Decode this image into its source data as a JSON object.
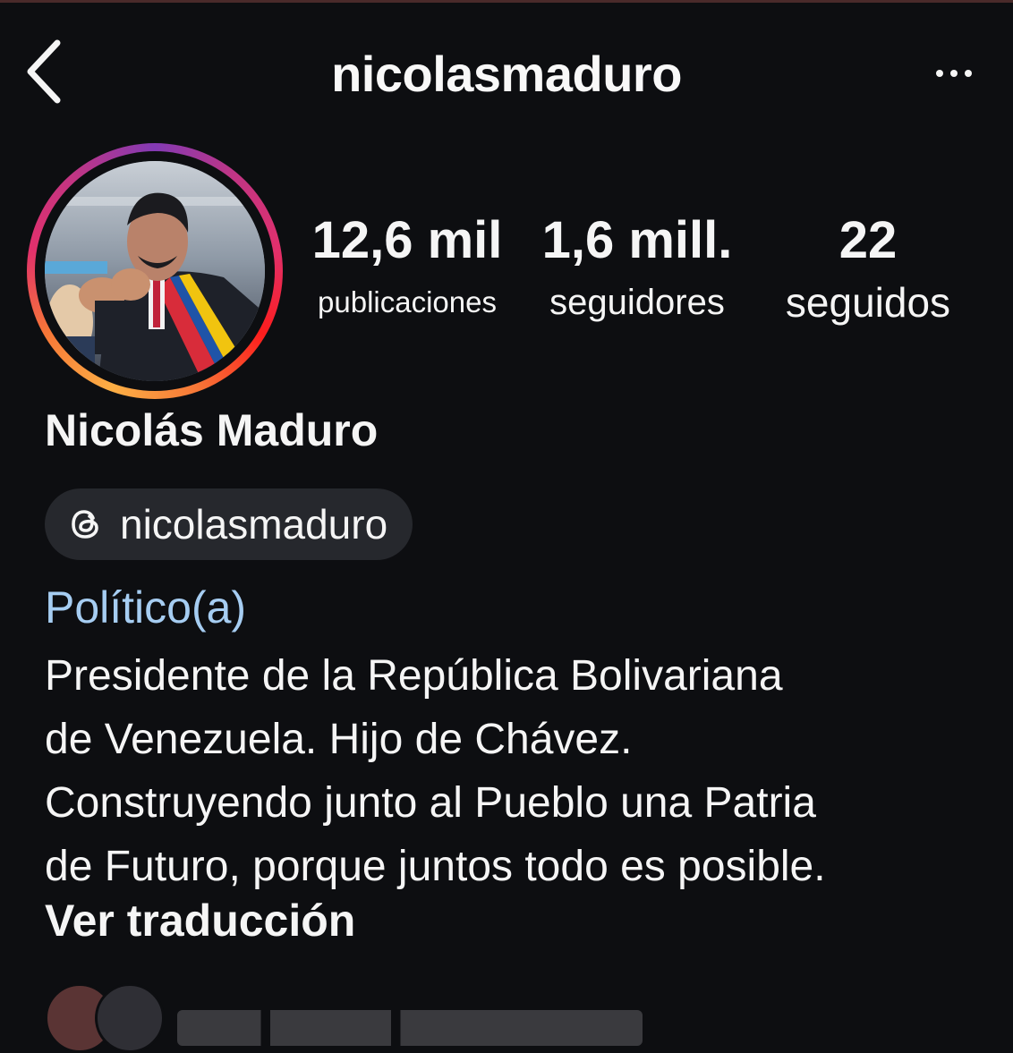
{
  "header": {
    "username": "nicolasmaduro",
    "back_icon": "chevron-left-icon",
    "more_icon": "more-horizontal-icon"
  },
  "profile": {
    "avatar_alt": "profile photo",
    "story_ring_colors": [
      "#fcaf45",
      "#f77737",
      "#e1306c",
      "#c13584",
      "#833ab4"
    ],
    "display_name": "Nicolás Maduro",
    "threads_handle": "nicolasmaduro",
    "threads_icon": "threads-icon",
    "category": "Político(a)",
    "bio_lines": [
      "Presidente de la República Bolivariana",
      "de Venezuela. Hijo de Chávez.",
      "Construyendo junto al Pueblo una Patria",
      "de Futuro, porque juntos todo es posible."
    ],
    "see_translation": "Ver traducción"
  },
  "stats": {
    "posts": {
      "value": "12,6 mil",
      "label": "publicaciones"
    },
    "followers": {
      "value": "1,6 mill.",
      "label": "seguidores"
    },
    "following": {
      "value": "22",
      "label": "seguidos"
    }
  },
  "colors": {
    "background": "#0d0e11",
    "text": "#f5f5f5",
    "category": "#a6cdf2",
    "pill": "#26282d"
  }
}
